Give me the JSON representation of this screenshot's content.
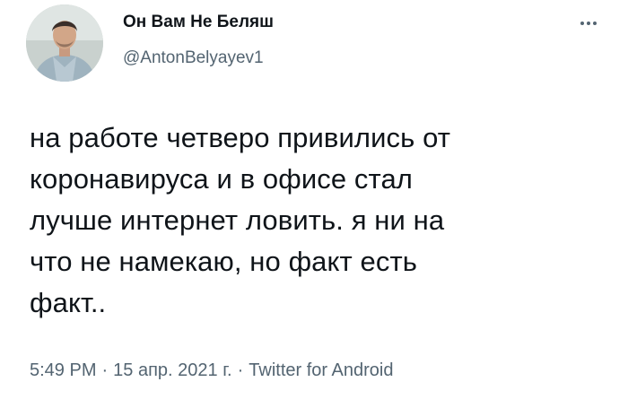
{
  "user": {
    "display_name": "Он Вам Не Беляш",
    "handle": "@AntonBelyayev1",
    "avatar": "avatar-photo"
  },
  "more_icon": "more-horizontal-icon",
  "tweet": {
    "text": "на работе четверо привились от\nкоронавируса и в офисе стал\nлучше интернет ловить. я ни на\nчто не намекаю, но факт есть\nфакт.."
  },
  "meta": {
    "time": "5:49 PM",
    "separator": "·",
    "date": "15 апр. 2021 г.",
    "source": "Twitter for Android"
  },
  "colors": {
    "text": "#0f1419",
    "secondary": "#536471",
    "background": "#ffffff"
  }
}
